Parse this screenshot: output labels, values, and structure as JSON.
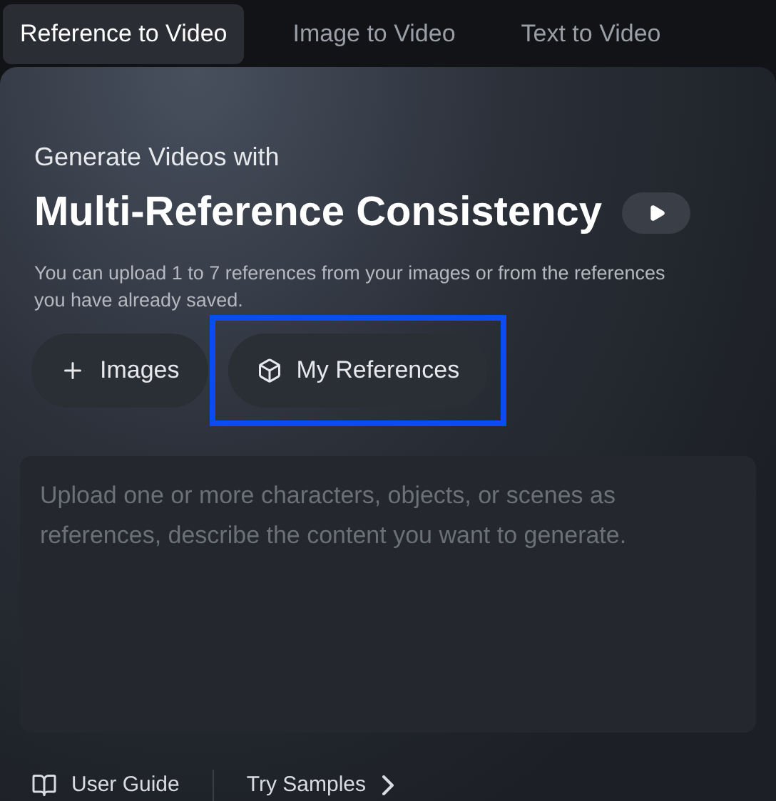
{
  "tabs": [
    {
      "label": "Reference to Video",
      "selected": true
    },
    {
      "label": "Image to Video",
      "selected": false
    },
    {
      "label": "Text to Video",
      "selected": false
    }
  ],
  "header": {
    "subtitle": "Generate Videos with",
    "title": "Multi-Reference Consistency",
    "description": "You can upload 1 to 7 references from your images or from the references you have already saved."
  },
  "buttons": [
    {
      "kind": "add",
      "label": "Images",
      "highlighted": false
    },
    {
      "kind": "references",
      "label": "My References",
      "highlighted": true
    }
  ],
  "prompt": {
    "placeholder": "Upload one or more characters, objects, or scenes as references, describe the content you want to generate."
  },
  "footer": [
    {
      "kind": "guide",
      "label": "User Guide"
    },
    {
      "kind": "samples",
      "label": "Try Samples"
    }
  ]
}
